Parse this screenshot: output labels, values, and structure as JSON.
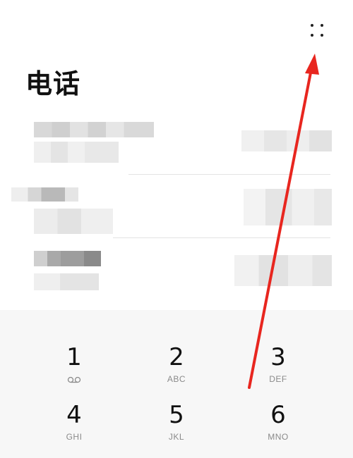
{
  "header": {
    "title": "电话",
    "more_icon": "four-dots-menu-icon"
  },
  "recent_calls": [
    {
      "blurred": true
    },
    {
      "blurred": true
    },
    {
      "blurred": true
    }
  ],
  "dialpad": {
    "keys": [
      {
        "digit": "1",
        "letters": "",
        "icon": "voicemail-icon"
      },
      {
        "digit": "2",
        "letters": "ABC"
      },
      {
        "digit": "3",
        "letters": "DEF"
      },
      {
        "digit": "4",
        "letters": "GHI"
      },
      {
        "digit": "5",
        "letters": "JKL"
      },
      {
        "digit": "6",
        "letters": "MNO"
      }
    ]
  },
  "annotation": {
    "arrow_color": "#e8261f"
  },
  "colors": {
    "background": "#ffffff",
    "dialpad_bg": "#f7f7f7",
    "text": "#111111",
    "secondary_text": "#8a8a8a"
  }
}
